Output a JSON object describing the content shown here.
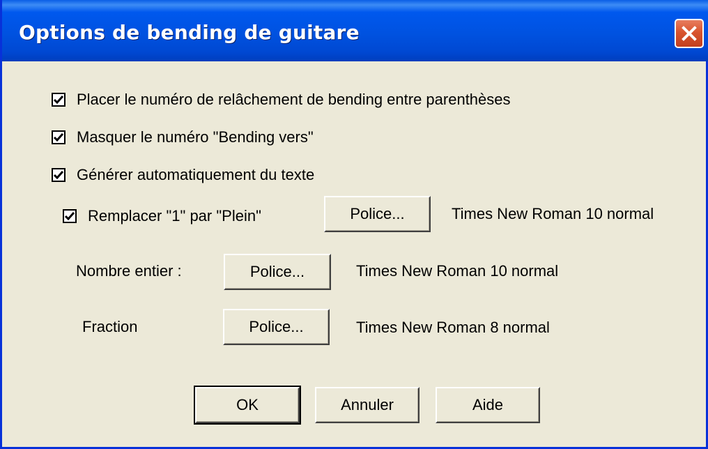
{
  "window": {
    "title": "Options de bending de guitare",
    "close_icon": "close-icon"
  },
  "options": {
    "parentheses": {
      "label": "Placer le numéro de relâchement de bending entre parenthèses",
      "checked": true
    },
    "hide_bend_to": {
      "label": "Masquer le numéro \"Bending vers\"",
      "checked": true
    },
    "auto_text": {
      "label": "Générer automatiquement du texte",
      "checked": true
    },
    "replace_full": {
      "label": "Remplacer \"1\" par \"Plein\"",
      "checked": true
    }
  },
  "fonts": {
    "full": {
      "button_label": "Police...",
      "description": "Times New Roman 10 normal"
    },
    "whole_number": {
      "label": "Nombre entier :",
      "button_label": "Police...",
      "description": "Times New Roman 10 normal"
    },
    "fraction": {
      "label": "Fraction",
      "button_label": "Police...",
      "description": "Times New Roman 8 normal"
    }
  },
  "buttons": {
    "ok": "OK",
    "cancel": "Annuler",
    "help": "Aide"
  },
  "colors": {
    "titlebar": "#0054e3",
    "face": "#ece9d8",
    "close": "#d9542e"
  }
}
